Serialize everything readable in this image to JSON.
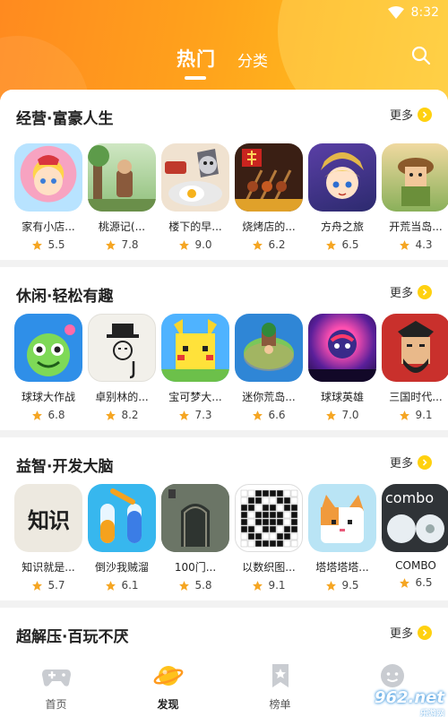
{
  "status_bar": {
    "time": "8:32",
    "icons": [
      "wifi-icon",
      "battery-icon"
    ]
  },
  "header": {
    "tabs": [
      {
        "label": "热门",
        "active": true
      },
      {
        "label": "分类",
        "active": false
      }
    ],
    "search_icon": "search-icon"
  },
  "sections": [
    {
      "title": "经营·富豪人生",
      "more": "更多",
      "apps": [
        {
          "name": "家有小店...",
          "rating": "5.5"
        },
        {
          "name": "桃源记(...",
          "rating": "7.8"
        },
        {
          "name": "楼下的早...",
          "rating": "9.0"
        },
        {
          "name": "烧烤店的...",
          "rating": "6.2"
        },
        {
          "name": "方舟之旅",
          "rating": "6.5"
        },
        {
          "name": "开荒当岛...",
          "rating": "4.3"
        }
      ]
    },
    {
      "title": "休闲·轻松有趣",
      "more": "更多",
      "apps": [
        {
          "name": "球球大作战",
          "rating": "6.8"
        },
        {
          "name": "卓别林的...",
          "rating": "8.2"
        },
        {
          "name": "宝可梦大...",
          "rating": "7.3"
        },
        {
          "name": "迷你荒岛...",
          "rating": "6.6"
        },
        {
          "name": "球球英雄",
          "rating": "7.0"
        },
        {
          "name": "三国时代...",
          "rating": "9.1"
        }
      ]
    },
    {
      "title": "益智·开发大脑",
      "more": "更多",
      "apps": [
        {
          "name": "知识就是...",
          "rating": "5.7",
          "icon_text": "知识"
        },
        {
          "name": "倒沙我贼溜",
          "rating": "6.1"
        },
        {
          "name": "100门...",
          "rating": "5.8"
        },
        {
          "name": "以数织图...",
          "rating": "9.1"
        },
        {
          "name": "塔塔塔塔...",
          "rating": "9.5"
        },
        {
          "name": "COMBO",
          "rating": "6.5",
          "icon_text": "combo"
        }
      ]
    },
    {
      "title": "超解压·百玩不厌",
      "more": "更多"
    }
  ],
  "bottom_nav": [
    {
      "label": "首页",
      "icon": "gamepad-icon",
      "active": false
    },
    {
      "label": "发现",
      "icon": "planet-icon",
      "active": true
    },
    {
      "label": "榜单",
      "icon": "bookmark-star-icon",
      "active": false
    },
    {
      "label": "",
      "icon": "smiley-icon",
      "active": false
    }
  ],
  "watermark": {
    "text": "962.net",
    "sub": "乐游网"
  },
  "colors": {
    "accent": "#FF9A1E",
    "star": "#F5A623",
    "more_badge": "#FFD10F"
  }
}
